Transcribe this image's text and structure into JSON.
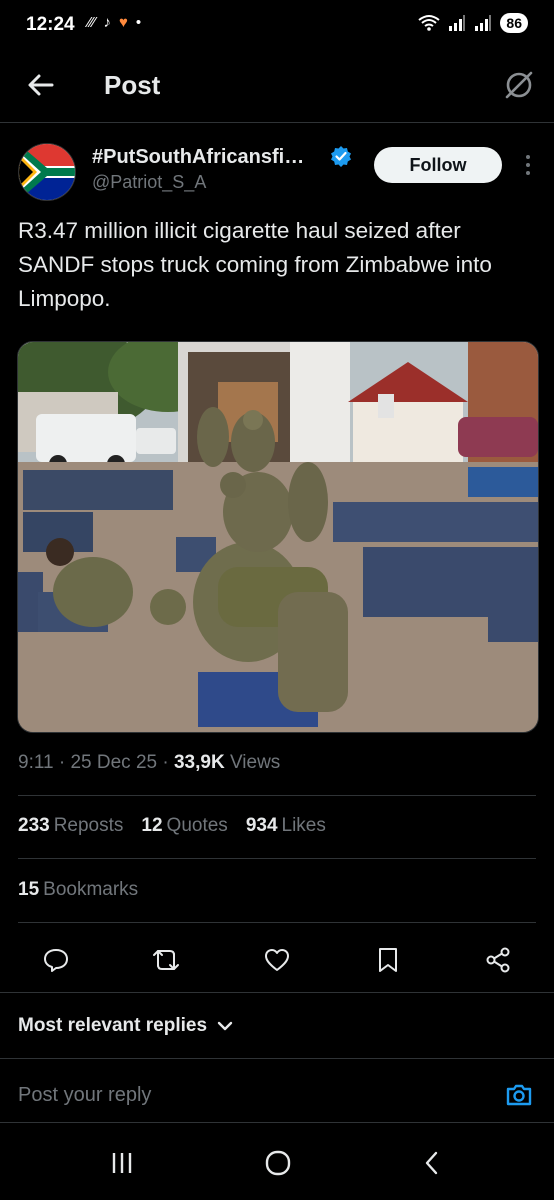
{
  "status_bar": {
    "time": "12:24",
    "left_icons": [
      "voicemail-icon",
      "tiktok-icon",
      "heart-app-icon",
      "dot-icon"
    ],
    "battery": "86"
  },
  "header": {
    "title": "Post",
    "back_icon": "back-arrow-icon",
    "grok_icon": "grok-icon"
  },
  "author": {
    "display_name": "#PutSouthAfricansfi…",
    "handle": "@Patriot_S_A",
    "verified_color": "#1d9bf0",
    "follow_label": "Follow"
  },
  "tweet": {
    "text": "R3.47 million illicit cigarette haul seized after SANDF stops truck coming from Zimbabwe into Limpopo."
  },
  "meta": {
    "time": "9:11",
    "date": "25 Dec 25",
    "views_count": "33,9K",
    "views_label": "Views"
  },
  "stats": {
    "reposts_count": "233",
    "reposts_label": "Reposts",
    "quotes_count": "12",
    "quotes_label": "Quotes",
    "likes_count": "934",
    "likes_label": "Likes",
    "bookmarks_count": "15",
    "bookmarks_label": "Bookmarks"
  },
  "actions": [
    "reply-icon",
    "repost-icon",
    "like-icon",
    "bookmark-icon",
    "share-icon"
  ],
  "replies": {
    "sort_label": "Most relevant replies",
    "placeholder": "Post your reply"
  },
  "colors": {
    "background": "#000000",
    "text": "#e7e9ea",
    "muted": "#71767b",
    "accent": "#1d9bf0",
    "divider": "#2f3336"
  }
}
